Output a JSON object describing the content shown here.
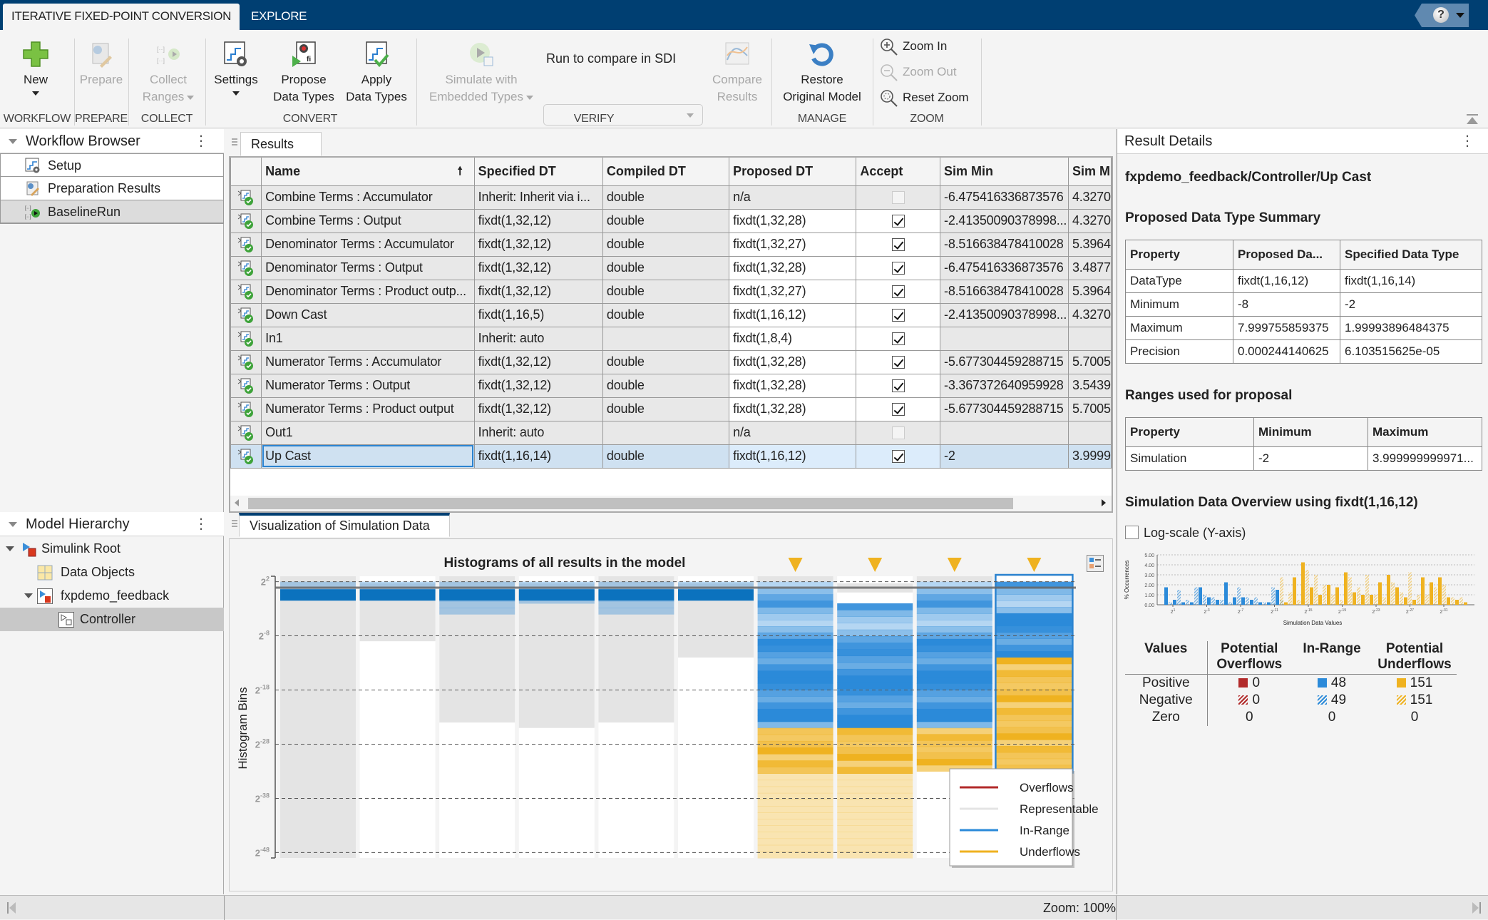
{
  "tabs": {
    "active": "ITERATIVE FIXED-POINT CONVERSION",
    "other": "EXPLORE"
  },
  "help": {
    "icon": "help-icon"
  },
  "toolbar": {
    "new": "New",
    "prepare": "Prepare",
    "collect_1": "Collect",
    "collect_2": "Ranges",
    "settings": "Settings",
    "propose_1": "Propose",
    "propose_2": "Data Types",
    "apply_1": "Apply",
    "apply_2": "Data Types",
    "simulate_1": "Simulate with",
    "simulate_2": "Embedded Types",
    "sdi_label": "Run to compare in SDI",
    "sdi_value": "",
    "compare_1": "Compare",
    "compare_2": "Results",
    "restore_1": "Restore",
    "restore_2": "Original Model",
    "zoom_in": "Zoom In",
    "zoom_out": "Zoom Out",
    "reset_zoom": "Reset Zoom",
    "groups": {
      "workflow": "WORKFLOW",
      "prepare": "PREPARE",
      "collect": "COLLECT",
      "convert": "CONVERT",
      "verify": "VERIFY",
      "manage": "MANAGE",
      "zoom": "ZOOM"
    }
  },
  "workflow_browser": {
    "title": "Workflow Browser",
    "items": [
      {
        "label": "Setup",
        "icon": "setup-icon"
      },
      {
        "label": "Preparation Results",
        "icon": "preparation-icon"
      },
      {
        "label": "BaselineRun",
        "icon": "run-icon",
        "selected": true
      }
    ]
  },
  "model_hierarchy": {
    "title": "Model Hierarchy",
    "items": [
      {
        "label": "Simulink Root",
        "level": 0,
        "expanded": true
      },
      {
        "label": "Data Objects",
        "level": 1
      },
      {
        "label": "fxpdemo_feedback",
        "level": 1,
        "expanded": true
      },
      {
        "label": "Controller",
        "level": 2,
        "selected": true
      }
    ]
  },
  "results": {
    "tab": "Results",
    "columns": [
      "",
      "Name",
      "Specified DT",
      "Compiled DT",
      "Proposed DT",
      "Accept",
      "Sim Min",
      "Sim M"
    ],
    "rows": [
      {
        "name": "Combine Terms : Accumulator",
        "specified": "Inherit: Inherit via i...",
        "compiled": "double",
        "proposed": "n/a",
        "accept": null,
        "sim_min": "-6.475416336873576",
        "sim_max": "4.3270"
      },
      {
        "name": "Combine Terms : Output",
        "specified": "fixdt(1,32,12)",
        "compiled": "double",
        "proposed": "fixdt(1,32,28)",
        "accept": true,
        "sim_min": "-2.41350090378998...",
        "sim_max": "4.3270"
      },
      {
        "name": "Denominator Terms : Accumulator",
        "specified": "fixdt(1,32,12)",
        "compiled": "double",
        "proposed": "fixdt(1,32,27)",
        "accept": true,
        "sim_min": "-8.516638478410028",
        "sim_max": "5.3964"
      },
      {
        "name": "Denominator Terms : Output",
        "specified": "fixdt(1,32,12)",
        "compiled": "double",
        "proposed": "fixdt(1,32,28)",
        "accept": true,
        "sim_min": "-6.475416336873576",
        "sim_max": "3.4877"
      },
      {
        "name": "Denominator Terms : Product outp...",
        "specified": "fixdt(1,32,12)",
        "compiled": "double",
        "proposed": "fixdt(1,32,27)",
        "accept": true,
        "sim_min": "-8.516638478410028",
        "sim_max": "5.3964"
      },
      {
        "name": "Down Cast",
        "specified": "fixdt(1,16,5)",
        "compiled": "double",
        "proposed": "fixdt(1,16,12)",
        "accept": true,
        "sim_min": "-2.41350090378998...",
        "sim_max": "4.3270"
      },
      {
        "name": "In1",
        "specified": "Inherit: auto",
        "compiled": "",
        "proposed": "fixdt(1,8,4)",
        "accept": true,
        "sim_min": "",
        "sim_max": ""
      },
      {
        "name": "Numerator Terms : Accumulator",
        "specified": "fixdt(1,32,12)",
        "compiled": "double",
        "proposed": "fixdt(1,32,28)",
        "accept": true,
        "sim_min": "-5.677304459288715",
        "sim_max": "5.7005"
      },
      {
        "name": "Numerator Terms : Output",
        "specified": "fixdt(1,32,12)",
        "compiled": "double",
        "proposed": "fixdt(1,32,28)",
        "accept": true,
        "sim_min": "-3.367372640959928",
        "sim_max": "3.5439"
      },
      {
        "name": "Numerator Terms : Product output",
        "specified": "fixdt(1,32,12)",
        "compiled": "double",
        "proposed": "fixdt(1,32,28)",
        "accept": true,
        "sim_min": "-5.677304459288715",
        "sim_max": "5.7005"
      },
      {
        "name": "Out1",
        "specified": "Inherit: auto",
        "compiled": "",
        "proposed": "n/a",
        "accept": null,
        "sim_min": "",
        "sim_max": ""
      },
      {
        "name": "Up Cast",
        "specified": "fixdt(1,16,14)",
        "compiled": "double",
        "proposed": "fixdt(1,16,12)",
        "accept": true,
        "sim_min": "-2",
        "sim_max": "3.9999",
        "selected": true
      }
    ]
  },
  "visualization": {
    "tab": "Visualization of Simulation Data",
    "legend_toggle_icon": "legend-toggle-icon"
  },
  "result_details": {
    "title": "Result Details",
    "path": "fxpdemo_feedback/Controller/Up Cast",
    "summary_heading": "Proposed Data Type Summary",
    "summary_columns": [
      "Property",
      "Proposed Da...",
      "Specified Data Type"
    ],
    "summary_rows": [
      [
        "DataType",
        "fixdt(1,16,12)",
        "fixdt(1,16,14)"
      ],
      [
        "Minimum",
        "-8",
        "-2"
      ],
      [
        "Maximum",
        "7.999755859375",
        "1.99993896484375"
      ],
      [
        "Precision",
        "0.000244140625",
        "6.103515625e-05"
      ]
    ],
    "ranges_heading": "Ranges used for proposal",
    "ranges_columns": [
      "Property",
      "Minimum",
      "Maximum"
    ],
    "ranges_rows": [
      [
        "Simulation",
        "-2",
        "3.999999999971..."
      ]
    ],
    "overview_heading": "Simulation Data Overview using fixdt(1,16,12)",
    "log_scale_label": "Log-scale (Y-axis)",
    "log_scale_checked": false,
    "counts": {
      "columns": [
        "Values",
        "Potential Overflows",
        "In-Range",
        "Potential Underflows"
      ],
      "rows": [
        {
          "label": "Positive",
          "overflows": "0",
          "inrange": "48",
          "underflows": "151"
        },
        {
          "label": "Negative",
          "overflows": "0",
          "inrange": "49",
          "underflows": "151"
        },
        {
          "label": "Zero",
          "overflows": "0",
          "inrange": "0",
          "underflows": "0"
        }
      ]
    }
  },
  "colors": {
    "overflow": "#b22a2a",
    "representable": "#e4e4e4",
    "inrange": "#2b8ad9",
    "underflow": "#efb220",
    "accent": "#003f72"
  },
  "status": {
    "zoom": "Zoom: 100%"
  },
  "chart_data": [
    {
      "type": "heatmap",
      "title": "Histograms of all results in the model",
      "ylabel": "Histogram Bins",
      "yticks": [
        "2^2",
        "2^-8",
        "2^-18",
        "2^-28",
        "2^-38",
        "2^-48"
      ],
      "y_exponent_range": [
        -49,
        3
      ],
      "legend": [
        "Overflows",
        "Representable",
        "In-Range",
        "Underflows"
      ],
      "legend_position": "bottom-right",
      "columns": [
        {
          "name": "Combine Terms : Accumulator",
          "representable": [
            3,
            -49
          ],
          "inrange": [
            2,
            0
          ],
          "underflow": null,
          "warning": false
        },
        {
          "name": "Combine Terms : Output",
          "representable": [
            3,
            -9
          ],
          "inrange": [
            2,
            0
          ],
          "underflow": null,
          "warning": false
        },
        {
          "name": "Denominator Terms : Accumulator",
          "representable": [
            3,
            -24
          ],
          "inrange": [
            2,
            -4
          ],
          "underflow": null,
          "warning": false
        },
        {
          "name": "Denominator Terms : Output",
          "representable": [
            3,
            -25
          ],
          "inrange": [
            2,
            -2
          ],
          "underflow": null,
          "warning": false
        },
        {
          "name": "Denominator Terms : Product output",
          "representable": [
            3,
            -24
          ],
          "inrange": [
            2,
            -4
          ],
          "underflow": null,
          "warning": false
        },
        {
          "name": "Down Cast",
          "representable": [
            3,
            -12
          ],
          "inrange": [
            2,
            -0.5
          ],
          "underflow": null,
          "warning": false
        },
        {
          "name": "In1",
          "representable": [
            3,
            2
          ],
          "inrange": [
            2,
            -25
          ],
          "underflow": [
            -25,
            -49
          ],
          "warning": true
        },
        {
          "name": "Numerator Terms : Accumulator",
          "representable": [
            3,
            0
          ],
          "inrange": [
            -2,
            -25
          ],
          "underflow": [
            -25,
            -49
          ],
          "warning": true
        },
        {
          "name": "Numerator Terms : Output",
          "representable": [
            3,
            2
          ],
          "inrange": [
            2,
            -25
          ],
          "underflow": [
            -25,
            -33
          ],
          "warning": true
        },
        {
          "name": "Up Cast",
          "representable": [
            3,
            2
          ],
          "inrange": [
            2,
            -12
          ],
          "underflow": [
            -12,
            -33
          ],
          "warning": true,
          "selected": true
        }
      ]
    },
    {
      "type": "bar",
      "title": "",
      "xlabel": "Simulation Data Values",
      "ylabel": "% Occurrences",
      "ylim": [
        0,
        5
      ],
      "yticks": [
        "0.00",
        "1.00",
        "2.00",
        "3.00",
        "4.00",
        "5.00"
      ],
      "xticks": [
        "2^1",
        "2^-3",
        "2^-7",
        "2^-11",
        "2^-15",
        "2^-19",
        "2^-23",
        "2^-27",
        "2^-31"
      ],
      "series": [
        {
          "name": "In-Range Positive",
          "values": [
            1.75,
            0.5,
            0.25,
            0.25,
            1.75,
            0.75,
            0.5,
            2.25,
            0.75,
            0.75,
            0.5,
            0.25,
            0.25,
            1.5
          ]
        },
        {
          "name": "In-Range Negative",
          "values": [
            0.25,
            1.5,
            0.5,
            1.75,
            1.0,
            0.75,
            0.5,
            0.25,
            1.75,
            0.75,
            0.75,
            0.25,
            1.75,
            0.5
          ]
        },
        {
          "name": "Underflow Positive",
          "values": [
            0.25,
            2.75,
            4.25,
            1.75,
            1.0,
            2.0,
            1.75,
            3.25,
            1.25,
            1.0,
            1.0,
            2.25,
            3.0,
            1.75,
            0.75,
            0.5,
            2.75,
            2.25,
            2.75,
            0.75,
            0.5,
            0.25
          ]
        },
        {
          "name": "Underflow Negative",
          "values": [
            2.75,
            1.25,
            0.5,
            3.5,
            3.0,
            2.0,
            1.0,
            0.5,
            2.75,
            1.75,
            3.0,
            1.0,
            0.75,
            2.25,
            1.25,
            3.25,
            1.0,
            1.0,
            1.75,
            2.0,
            0.75,
            0.75
          ]
        }
      ]
    }
  ]
}
